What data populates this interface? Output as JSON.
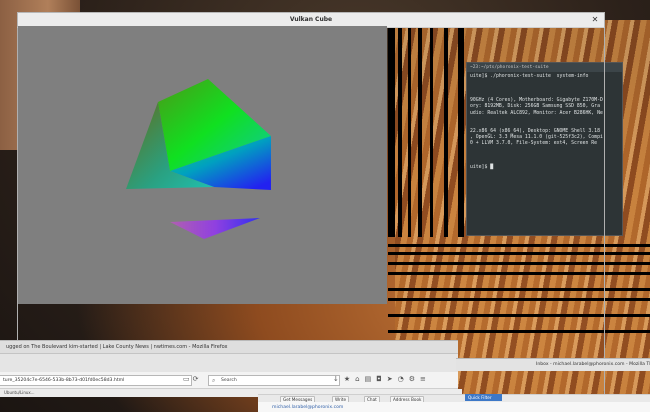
{
  "vulkan": {
    "title": "Vulkan Cube"
  },
  "terminal": {
    "title": "~23:~/pts/phoronix-test-suite",
    "lines": [
      "uite]$ ./phoronix-test-suite  system-info",
      "",
      "",
      "",
      "90GHz (4 Cores), Motherboard: Gigabyte Z170M-D",
      "ory: 8192MB, Disk: 256GB Samsung SSD 850, Gra",
      "udio: Realtek ALC892, Monitor: Acer B286HK, Ne",
      "",
      "",
      "22.x86_64 (x86_64), Desktop: GNOME Shell 3.18",
      ", OpenGL: 3.3 Mesa 11.1.0 (git-525f3c2), Compi",
      "0 + LLVM 3.7.0, File-System: ext4, Screen Re",
      "",
      "",
      "",
      "uite]$ █"
    ]
  },
  "firefox": {
    "window_title": "ugged on The Boulevard kim-started | Lake County News | nwtimes.com - Mozilla Firefox",
    "url": "ture_35204c7e-6546-533b-8b73-d01fd0ec58d3.html",
    "search_placeholder": "Search",
    "bookmarks_text": "Ubuntu/Linux..."
  },
  "thunderbird": {
    "window_title": "Inbox - michael.larabel@phoronix.com - Mozilla Thunderbird",
    "buttons": {
      "get_messages": "Get Messages",
      "write": "Write",
      "chat": "Chat",
      "address_book": "Address Book",
      "quick_filter": "Quick Filter"
    },
    "account": "michael.larabel@phoronix.com"
  },
  "colors": {
    "cube_background": "#7f7f7f",
    "terminal_bg": "#2d3436",
    "accent": "#3d78c7"
  }
}
